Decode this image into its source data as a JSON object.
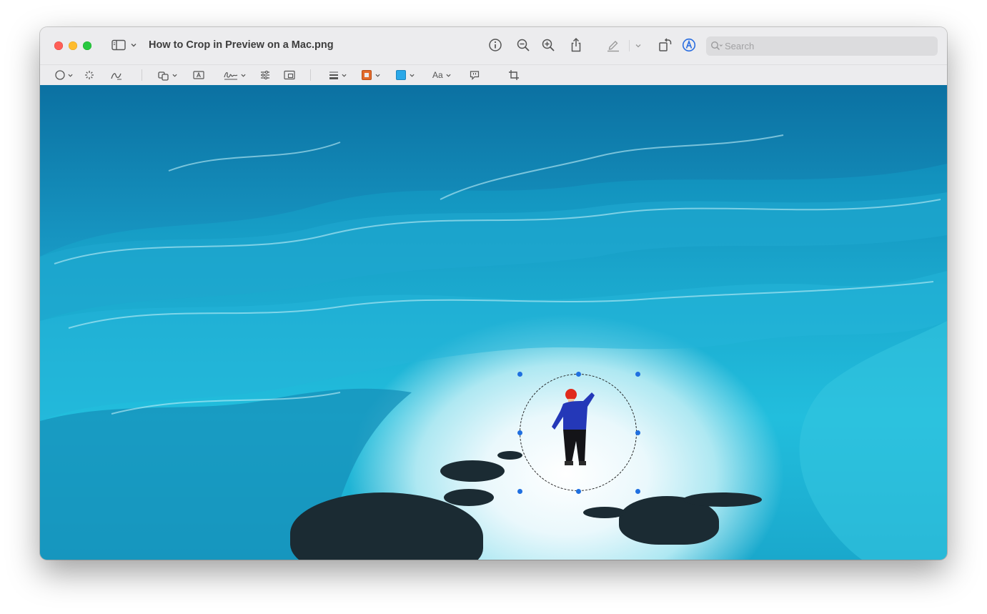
{
  "window": {
    "title": "How to Crop in Preview on a Mac.png",
    "traffic_lights": [
      "close",
      "minimize",
      "zoom"
    ]
  },
  "titlebar": {
    "buttons": [
      "sidebar-icon",
      "info-icon",
      "zoom-out-icon",
      "zoom-in-icon",
      "share-icon",
      "highlight-icon",
      "rotate-icon",
      "markup-icon"
    ]
  },
  "search": {
    "placeholder": "Search",
    "value": ""
  },
  "markup_toolbar": {
    "tools": [
      "selection-tools",
      "instant-alpha",
      "sketch",
      "shapes",
      "text",
      "sign",
      "adjust-color",
      "adjust-size",
      "shape-style",
      "border-color",
      "fill-color",
      "text-style",
      "annotate",
      "crop"
    ],
    "text_style_label": "Aa",
    "border_color": "#e26a2c",
    "fill_color": "#2aa8e8"
  },
  "document": {
    "image_description_colors": {
      "ice": "#1aa6cc",
      "light": "#ffffff",
      "rock": "#1b2b33"
    },
    "selection": {
      "shape": "circle",
      "handles": 8,
      "handle_color": "#1f6fe0"
    }
  }
}
